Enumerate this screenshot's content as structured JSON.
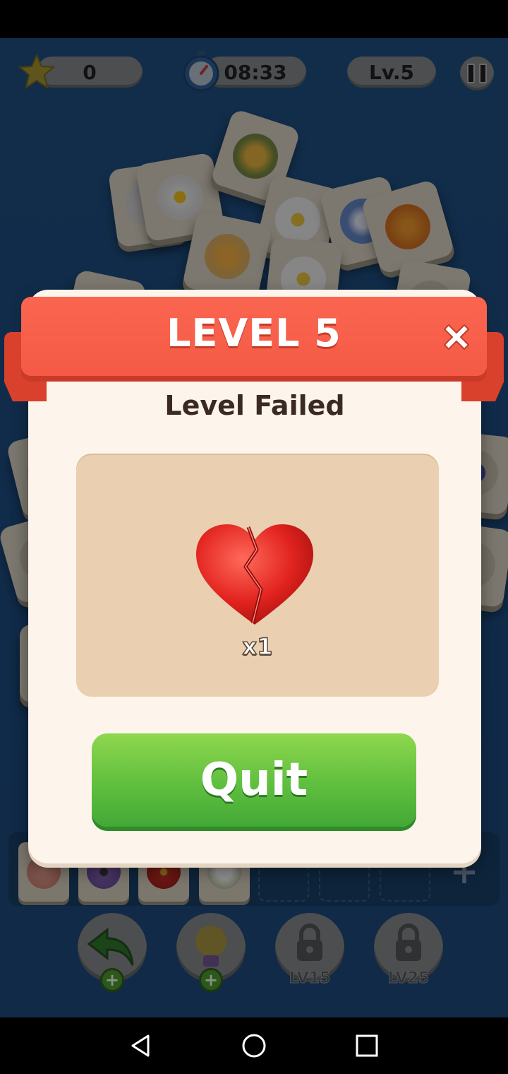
{
  "hud": {
    "stars": "0",
    "timer": "08:33",
    "level": "Lv.5",
    "icons": [
      "star-icon",
      "stopwatch-icon",
      "pause-icon"
    ]
  },
  "dialog": {
    "title": "LEVEL 5",
    "subtitle": "Level Failed",
    "reward_count": "x1",
    "quit_label": "Quit",
    "icons": [
      "close-icon",
      "broken-heart-icon"
    ]
  },
  "tools": {
    "undo_icon": "undo-arrow-icon",
    "hint_icon": "lightbulb-icon",
    "lock1_label": "LV15",
    "lock2_label": "LV25"
  },
  "tray": {
    "slots": [
      "rose",
      "purple-flower",
      "red-hibiscus",
      "white-flowers",
      "",
      "",
      ""
    ]
  },
  "colors": {
    "ribbon": "#f45a45",
    "quit_button": "#5fbf3e",
    "panel": "#eacfb0",
    "dialog_bg": "#fdf4ec"
  },
  "nav": {
    "icons": [
      "back-icon",
      "home-icon",
      "recents-icon"
    ]
  }
}
